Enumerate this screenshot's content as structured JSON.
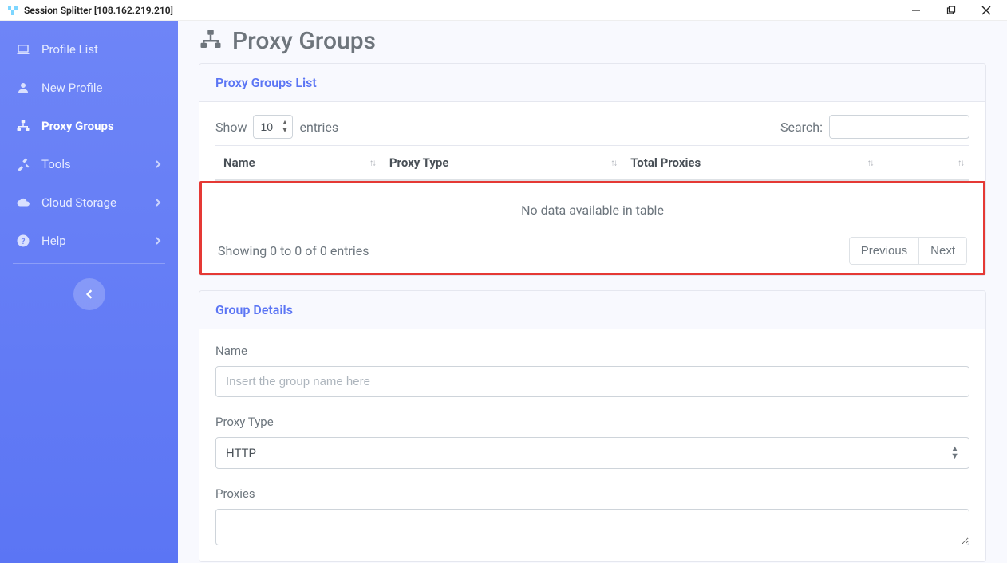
{
  "window": {
    "title": "Session Splitter [108.162.219.210]"
  },
  "sidebar": {
    "items": [
      {
        "label": "Profile List"
      },
      {
        "label": "New Profile"
      },
      {
        "label": "Proxy Groups"
      },
      {
        "label": "Tools"
      },
      {
        "label": "Cloud Storage"
      },
      {
        "label": "Help"
      }
    ]
  },
  "page": {
    "title": "Proxy Groups"
  },
  "list_card": {
    "title": "Proxy Groups List",
    "show_label_pre": "Show",
    "show_label_post": "entries",
    "entries_value": "10",
    "search_label": "Search:",
    "columns": {
      "name": "Name",
      "proxy_type": "Proxy Type",
      "total_proxies": "Total Proxies"
    },
    "no_data": "No data available in table",
    "info": "Showing 0 to 0 of 0 entries",
    "prev": "Previous",
    "next": "Next"
  },
  "details_card": {
    "title": "Group Details",
    "name_label": "Name",
    "name_placeholder": "Insert the group name here",
    "proxy_type_label": "Proxy Type",
    "proxy_type_value": "HTTP",
    "proxies_label": "Proxies"
  }
}
